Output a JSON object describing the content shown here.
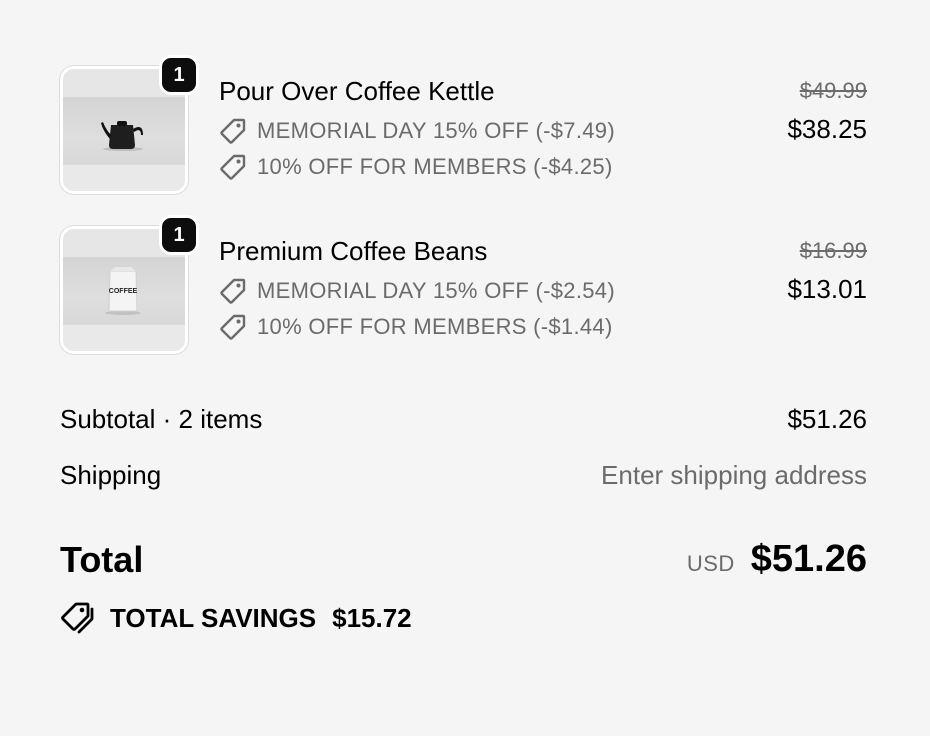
{
  "cart": {
    "items": [
      {
        "quantity": "1",
        "name": "Pour Over Coffee Kettle",
        "image_icon": "kettle-image",
        "discounts": [
          "MEMORIAL DAY 15% OFF (-$7.49)",
          "10% OFF FOR MEMBERS (-$4.25)"
        ],
        "original_price": "$49.99",
        "final_price": "$38.25"
      },
      {
        "quantity": "1",
        "name": "Premium Coffee Beans",
        "image_icon": "coffee-bag-image",
        "image_text": "COFFEE",
        "discounts": [
          "MEMORIAL DAY 15% OFF (-$2.54)",
          "10% OFF FOR MEMBERS (-$1.44)"
        ],
        "original_price": "$16.99",
        "final_price": "$13.01"
      }
    ]
  },
  "totals": {
    "subtotal_label": "Subtotal · 2 items",
    "subtotal_value": "$51.26",
    "shipping_label": "Shipping",
    "shipping_value": "Enter shipping address",
    "total_label": "Total",
    "currency": "USD",
    "total_value": "$51.26",
    "savings_label": "TOTAL SAVINGS",
    "savings_value": "$15.72"
  },
  "icons": {
    "discount": "tag-icon",
    "savings": "tags-icon"
  },
  "colors": {
    "background": "#f5f5f5",
    "text": "#000000",
    "muted_text": "#6b6b6b",
    "badge": "#0d0d0d"
  }
}
